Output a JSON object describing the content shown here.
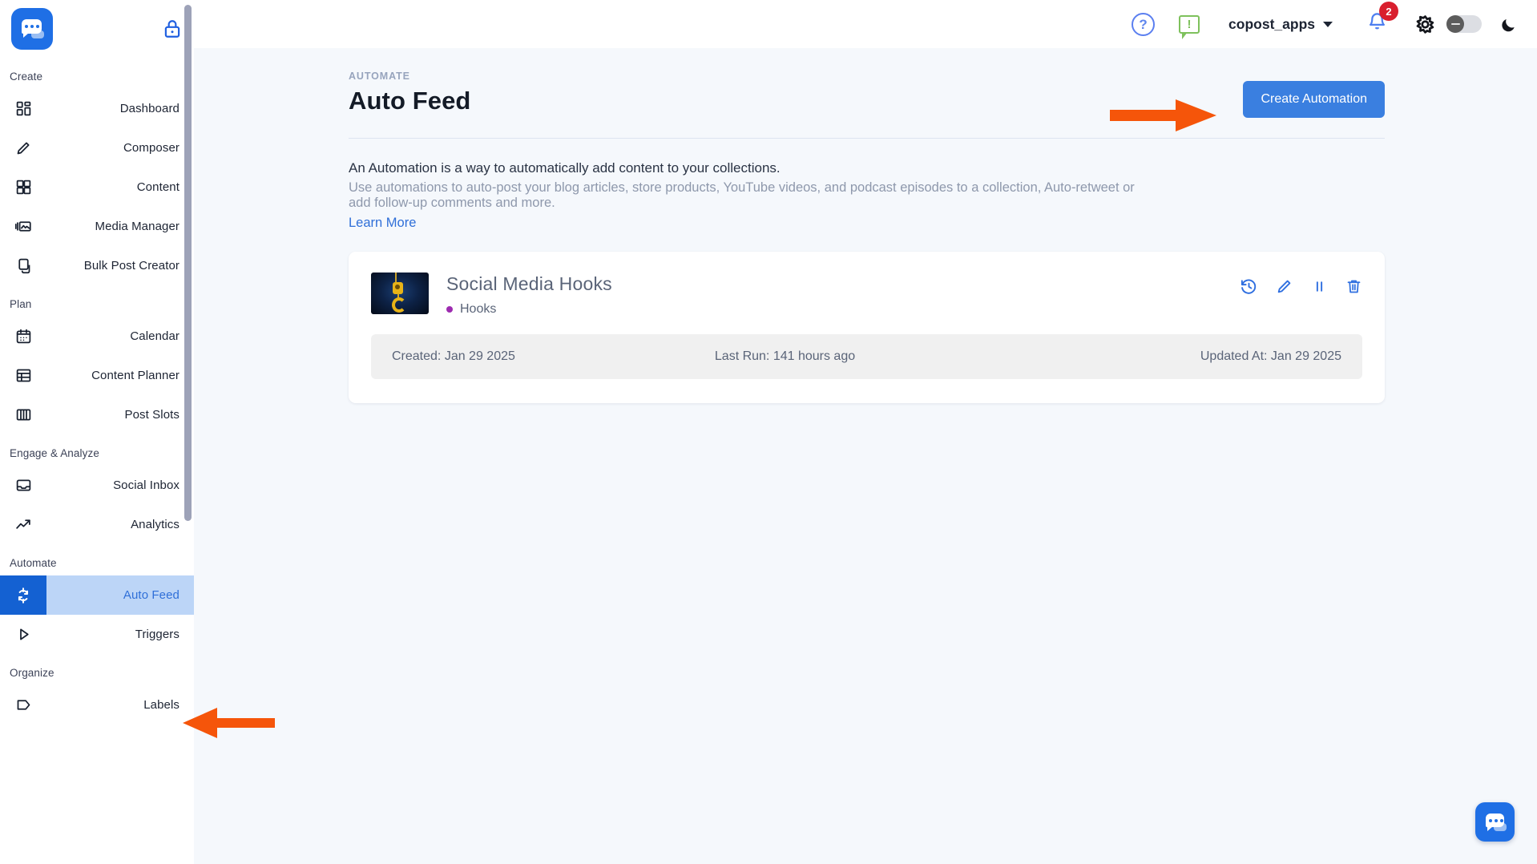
{
  "app": {
    "logo_icon": "chat-bubble-logo",
    "lock_icon": "lock-icon"
  },
  "sidebar": {
    "groups": [
      {
        "label": "Create",
        "items": [
          {
            "label": "Dashboard",
            "icon": "dashboard-grid-icon",
            "active": false
          },
          {
            "label": "Composer",
            "icon": "pencil-icon",
            "active": false
          },
          {
            "label": "Content",
            "icon": "grid-icon",
            "active": false
          },
          {
            "label": "Media Manager",
            "icon": "media-image-icon",
            "active": false
          },
          {
            "label": "Bulk Post Creator",
            "icon": "copy-stack-icon",
            "active": false
          }
        ]
      },
      {
        "label": "Plan",
        "items": [
          {
            "label": "Calendar",
            "icon": "calendar-icon",
            "active": false
          },
          {
            "label": "Content Planner",
            "icon": "table-icon",
            "active": false
          },
          {
            "label": "Post Slots",
            "icon": "columns-icon",
            "active": false
          }
        ]
      },
      {
        "label": "Engage & Analyze",
        "items": [
          {
            "label": "Social Inbox",
            "icon": "inbox-icon",
            "active": false
          },
          {
            "label": "Analytics",
            "icon": "trend-up-icon",
            "active": false
          }
        ]
      },
      {
        "label": "Automate",
        "items": [
          {
            "label": "Auto Feed",
            "icon": "refresh-cycle-icon",
            "active": true
          },
          {
            "label": "Triggers",
            "icon": "play-triangle-icon",
            "active": false
          }
        ]
      },
      {
        "label": "Organize",
        "items": [
          {
            "label": "Labels",
            "icon": "tag-icon",
            "active": false
          }
        ]
      }
    ]
  },
  "topbar": {
    "help_icon": "question-mark-circle-icon",
    "help_glyph": "?",
    "feedback_icon": "feedback-bubble-icon",
    "feedback_glyph": "!",
    "account_name": "copost_apps",
    "account_caret_icon": "chevron-down-icon",
    "bell_icon": "notification-bell-icon",
    "bell_badge": "2",
    "sun_icon": "sun-icon",
    "theme_toggle_icon": "theme-toggle-switch",
    "moon_icon": "moon-icon"
  },
  "page": {
    "eyebrow": "AUTOMATE",
    "title": "Auto Feed",
    "create_button": "Create Automation",
    "description_line1": "An Automation is a way to automatically add content to your collections.",
    "description_line2": "Use automations to auto-post your blog articles, store products, YouTube videos, and podcast episodes to a collection, Auto-retweet or add follow-up comments and more.",
    "learn_more": "Learn More"
  },
  "automation_card": {
    "thumbnail_icon": "crane-hook-thumbnail",
    "title": "Social Media Hooks",
    "collection_label": "Hooks",
    "collection_dot_color": "#9d2bb0",
    "actions": [
      {
        "name": "history-icon",
        "label": "History"
      },
      {
        "name": "edit-pencil-icon",
        "label": "Edit"
      },
      {
        "name": "pause-icon",
        "label": "Pause"
      },
      {
        "name": "delete-trash-icon",
        "label": "Delete"
      }
    ],
    "meta": {
      "created": "Created: Jan 29 2025",
      "last_run": "Last Run: 141 hours ago",
      "updated_at": "Updated At: Jan 29 2025"
    }
  },
  "annotations": {
    "arrow_color": "#f5550a",
    "arrow_to_create_button": "arrow-pointing-to-create-automation",
    "arrow_to_auto_feed": "arrow-pointing-to-auto-feed"
  },
  "chat_widget": {
    "icon": "chat-bubble-icon"
  },
  "colors": {
    "accent_blue": "#1f6fe5",
    "button_blue": "#3a7fe0",
    "active_nav_bg": "#bcd5f7",
    "page_bg": "#f5f8fc",
    "badge_red": "#d91f2e"
  }
}
